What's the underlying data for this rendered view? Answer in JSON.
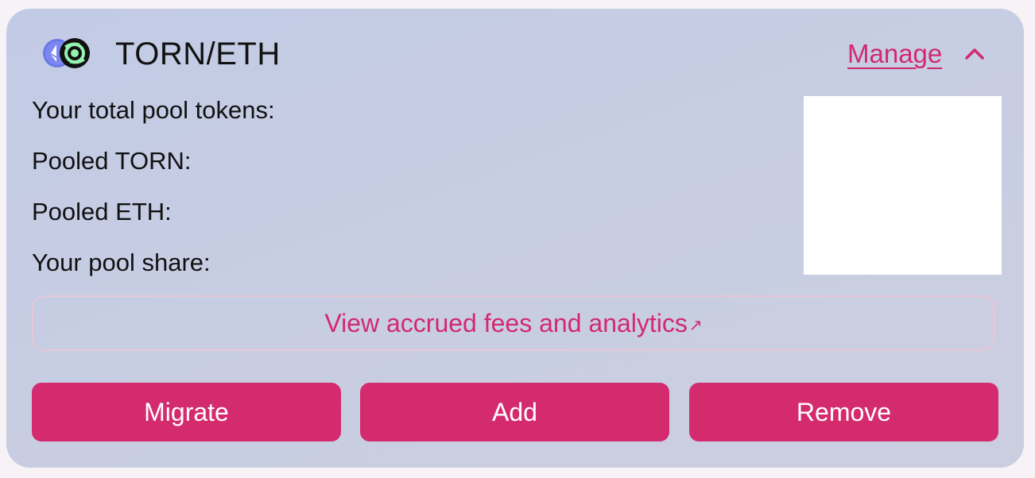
{
  "pool": {
    "pair": "TORN/ETH",
    "manage_label": "Manage",
    "expanded_icon": "chevron-up-icon",
    "token_icons": [
      "eth-icon",
      "torn-icon"
    ]
  },
  "details": {
    "total_tokens_label": "Your total pool tokens:",
    "pooled_torn_label": "Pooled TORN:",
    "pooled_eth_label": "Pooled ETH:",
    "pool_share_label": "Your pool share:"
  },
  "analytics": {
    "label": "View accrued fees and analytics",
    "arrow": "↗"
  },
  "actions": {
    "migrate": "Migrate",
    "add": "Add",
    "remove": "Remove"
  },
  "colors": {
    "accent": "#d42b6f",
    "card_bg": "#c5cce4",
    "text": "#111111"
  }
}
